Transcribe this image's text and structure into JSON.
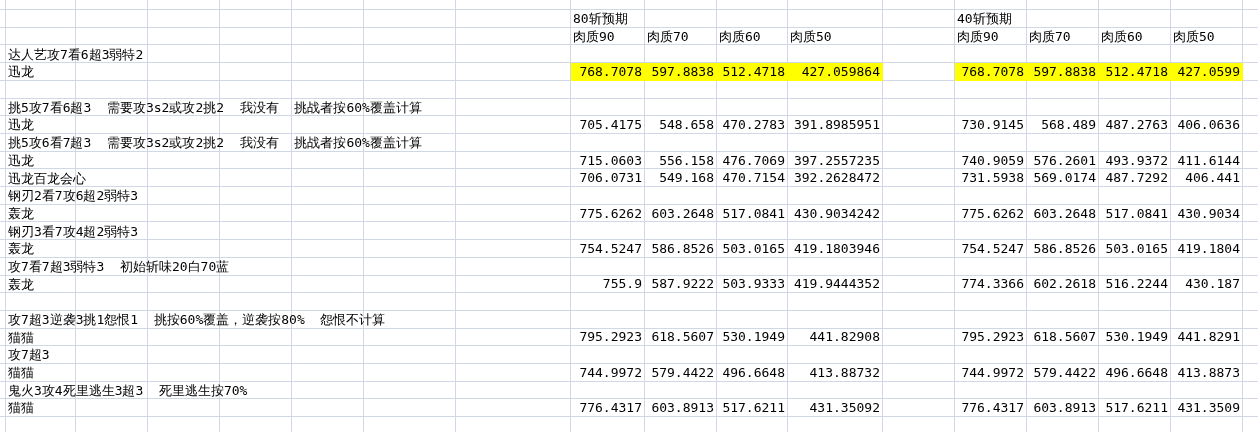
{
  "sheet": {
    "groups": [
      {
        "title": "80斩预期",
        "headers": [
          "肉质90",
          "肉质70",
          "肉质60",
          "肉质50"
        ]
      },
      {
        "title": "40斩预期",
        "headers": [
          "肉质90",
          "肉质70",
          "肉质60",
          "肉质50"
        ]
      }
    ],
    "rows": [
      {
        "kind": "note",
        "label": "达人艺攻7看6超3弱特2"
      },
      {
        "kind": "data",
        "label": "迅龙",
        "highlighted": true,
        "values": [
          [
            "768.7078",
            "597.8838",
            "512.4718",
            "427.059864"
          ],
          [
            "768.7078",
            "597.8838",
            "512.4718",
            "427.0599"
          ]
        ]
      },
      {
        "kind": "blank"
      },
      {
        "kind": "note",
        "label": "挑5攻7看6超3  需要攻3s2或攻2挑2  我没有  挑战者按60%覆盖计算"
      },
      {
        "kind": "data",
        "label": "迅龙",
        "highlighted": false,
        "values": [
          [
            "705.4175",
            "548.658",
            "470.2783",
            "391.8985951"
          ],
          [
            "730.9145",
            "568.489",
            "487.2763",
            "406.0636"
          ]
        ]
      },
      {
        "kind": "note",
        "label": "挑5攻6看7超3  需要攻3s2或攻2挑2  我没有  挑战者按60%覆盖计算"
      },
      {
        "kind": "data",
        "label": "迅龙",
        "highlighted": false,
        "values": [
          [
            "715.0603",
            "556.158",
            "476.7069",
            "397.2557235"
          ],
          [
            "740.9059",
            "576.2601",
            "493.9372",
            "411.6144"
          ]
        ]
      },
      {
        "kind": "data",
        "label": "迅龙百龙会心",
        "highlighted": false,
        "values": [
          [
            "706.0731",
            "549.168",
            "470.7154",
            "392.2628472"
          ],
          [
            "731.5938",
            "569.0174",
            "487.7292",
            "406.441"
          ]
        ]
      },
      {
        "kind": "note",
        "label": "钢刃2看7攻6超2弱特3"
      },
      {
        "kind": "data",
        "label": "轰龙",
        "highlighted": false,
        "values": [
          [
            "775.6262",
            "603.2648",
            "517.0841",
            "430.9034242"
          ],
          [
            "775.6262",
            "603.2648",
            "517.0841",
            "430.9034"
          ]
        ]
      },
      {
        "kind": "note",
        "label": "钢刃3看7攻4超2弱特3"
      },
      {
        "kind": "data",
        "label": "轰龙",
        "highlighted": false,
        "values": [
          [
            "754.5247",
            "586.8526",
            "503.0165",
            "419.1803946"
          ],
          [
            "754.5247",
            "586.8526",
            "503.0165",
            "419.1804"
          ]
        ]
      },
      {
        "kind": "note",
        "label": "攻7看7超3弱特3  初始斩味20白70蓝"
      },
      {
        "kind": "data",
        "label": "轰龙",
        "highlighted": false,
        "values": [
          [
            "755.9",
            "587.9222",
            "503.9333",
            "419.9444352"
          ],
          [
            "774.3366",
            "602.2618",
            "516.2244",
            "430.187"
          ]
        ]
      },
      {
        "kind": "blank"
      },
      {
        "kind": "note",
        "label": "攻7超3逆袭3挑1怨恨1  挑按60%覆盖，逆袭按80%  怨恨不计算"
      },
      {
        "kind": "data",
        "label": "猫猫",
        "highlighted": false,
        "values": [
          [
            "795.2923",
            "618.5607",
            "530.1949",
            "441.82908"
          ],
          [
            "795.2923",
            "618.5607",
            "530.1949",
            "441.8291"
          ]
        ]
      },
      {
        "kind": "note",
        "label": "攻7超3"
      },
      {
        "kind": "data",
        "label": "猫猫",
        "highlighted": false,
        "values": [
          [
            "744.9972",
            "579.4422",
            "496.6648",
            "413.88732"
          ],
          [
            "744.9972",
            "579.4422",
            "496.6648",
            "413.8873"
          ]
        ]
      },
      {
        "kind": "note",
        "label": "鬼火3攻4死里逃生3超3  死里逃生按70%"
      },
      {
        "kind": "data",
        "label": "猫猫",
        "highlighted": false,
        "values": [
          [
            "776.4317",
            "603.8913",
            "517.6211",
            "431.35092"
          ],
          [
            "776.4317",
            "603.8913",
            "517.6211",
            "431.3509"
          ]
        ]
      }
    ]
  }
}
